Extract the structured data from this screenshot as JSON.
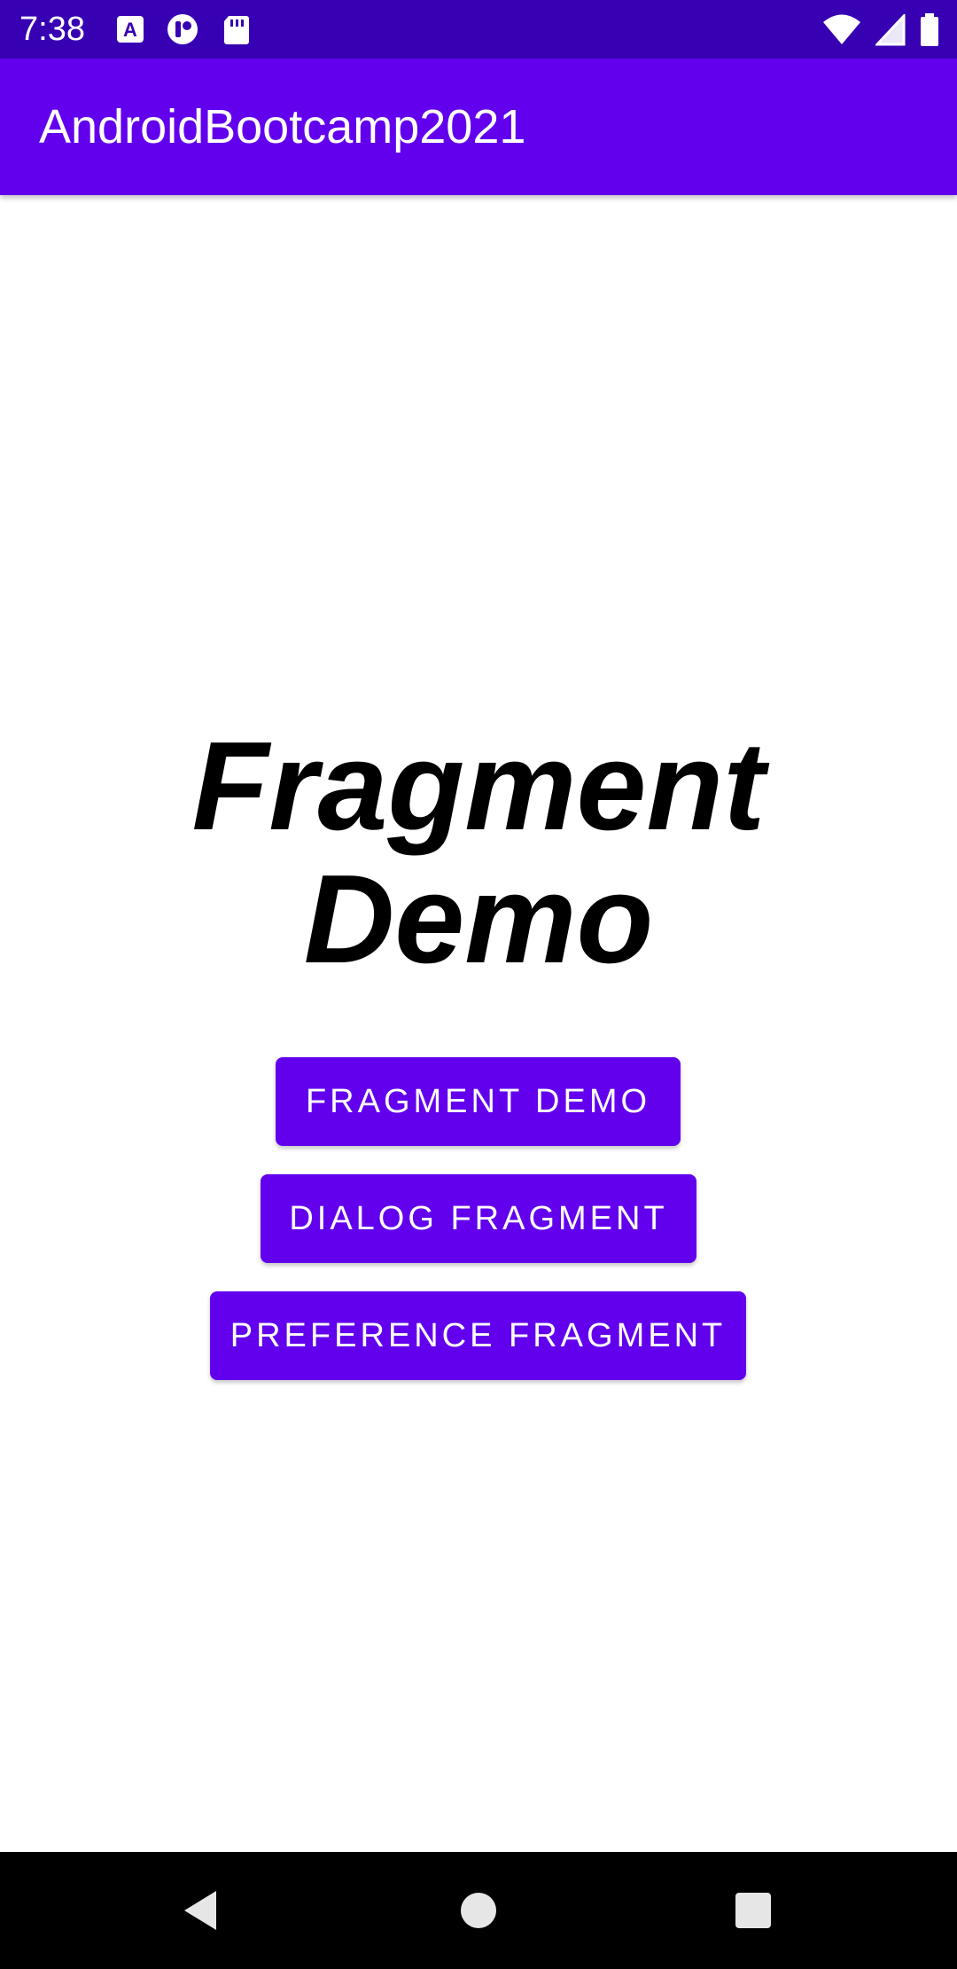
{
  "status_bar": {
    "time": "7:38",
    "left_icons": [
      "font-a-icon",
      "notification-icon",
      "sd-card-icon"
    ],
    "right_icons": [
      "wifi-icon",
      "signal-icon",
      "battery-icon"
    ]
  },
  "app_bar": {
    "title": "AndroidBootcamp2021"
  },
  "main": {
    "headline": "Fragment Demo",
    "buttons": [
      {
        "label": "FRAGMENT DEMO"
      },
      {
        "label": "DIALOG FRAGMENT"
      },
      {
        "label": "PREFERENCE FRAGMENT"
      }
    ]
  },
  "nav_bar": {
    "buttons": [
      "back-icon",
      "home-icon",
      "recents-icon"
    ]
  },
  "colors": {
    "status_bar": "#3700B3",
    "primary": "#6200EE",
    "background": "#FFFFFF",
    "headline": "#000000"
  }
}
